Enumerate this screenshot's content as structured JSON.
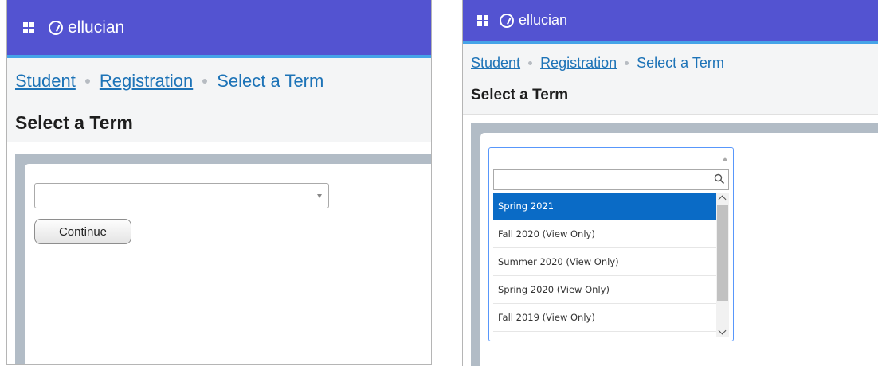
{
  "app": {
    "brand": "ellucian"
  },
  "breadcrumb": {
    "items": [
      "Student",
      "Registration",
      "Select a Term"
    ]
  },
  "page": {
    "title": "Select a Term"
  },
  "term_select": {
    "value": "",
    "dropdown_options": [
      "Spring 2021",
      "Fall 2020 (View Only)",
      "Summer 2020 (View Only)",
      "Spring 2020 (View Only)",
      "Fall 2019 (View Only)"
    ],
    "selected_option": "Spring 2021",
    "search_value": ""
  },
  "buttons": {
    "continue_label": "Continue"
  },
  "colors": {
    "header": "#5353d1",
    "header_accent": "#45a3e8",
    "link": "#1d73b7",
    "selected_option": "#0a6bc6"
  },
  "icons": {
    "app_menu": "grid-icon",
    "brand": "ellucian-logo-icon",
    "search": "search-icon"
  }
}
